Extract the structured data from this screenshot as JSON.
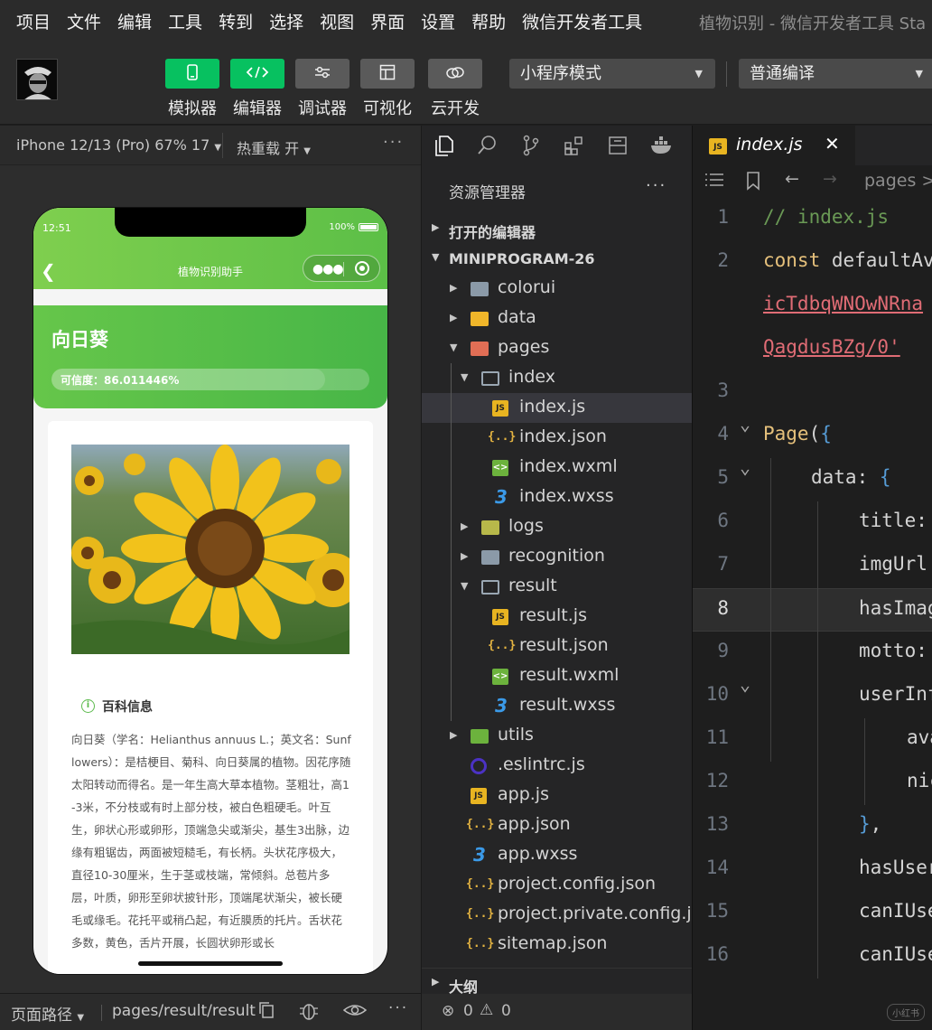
{
  "menubar": {
    "items": [
      "项目",
      "文件",
      "编辑",
      "工具",
      "转到",
      "选择",
      "视图",
      "界面",
      "设置",
      "帮助",
      "微信开发者工具"
    ],
    "window_title": "植物识别 - 微信开发者工具 Sta"
  },
  "toolbar": {
    "buttons": [
      {
        "label": "模拟器",
        "icon": "phone-icon",
        "active": true
      },
      {
        "label": "编辑器",
        "icon": "code-icon",
        "active": true
      },
      {
        "label": "调试器",
        "icon": "debug-icon",
        "active": false
      },
      {
        "label": "可视化",
        "icon": "layout-icon",
        "active": false
      },
      {
        "label": "云开发",
        "icon": "cloud-icon",
        "active": false
      }
    ],
    "mode_select": "小程序模式",
    "compile_select": "普通编译"
  },
  "simulator": {
    "device": "iPhone 12/13 (Pro) 67% 17",
    "hot_reload": "热重载 开",
    "more": "···",
    "status_time": "12:51",
    "battery": "100%",
    "nav_title": "植物识别助手",
    "plant_name": "向日葵",
    "confidence_text": "可信度：86.011446%",
    "confidence_value": 86.011446,
    "baike_title": "百科信息",
    "baike_text": "向日葵（学名：Helianthus annuus L.；英文名：Sunflowers）：是桔梗目、菊科、向日葵属的植物。因花序随太阳转动而得名。是一年生高大草本植物。茎粗壮，高1-3米，不分枝或有时上部分枝，被白色粗硬毛。叶互生，卵状心形或卵形，顶端急尖或渐尖，基生3出脉，边缘有粗锯齿，两面被短糙毛，有长柄。头状花序极大，直径10-30厘米，生于茎或枝端，常倾斜。总苞片多层，叶质，卵形至卵状披针形，顶端尾状渐尖，被长硬毛或缘毛。花托平或稍凸起，有近膜质的托片。舌状花多数，黄色，舌片开展，长圆状卵形或长",
    "footer_path_label": "页面路径",
    "footer_path": "pages/result/result"
  },
  "explorer": {
    "title": "资源管理器",
    "more": "···",
    "open_editors": "打开的编辑器",
    "project": "MINIPROGRAM-26",
    "outline": "大纲",
    "errors": "0",
    "warnings": "0",
    "tree": [
      {
        "name": "colorui",
        "type": "folder",
        "depth": 1,
        "chev": "▶"
      },
      {
        "name": "data",
        "type": "folder-data",
        "depth": 1,
        "chev": "▶"
      },
      {
        "name": "pages",
        "type": "folder-pages",
        "depth": 1,
        "chev": "▼"
      },
      {
        "name": "index",
        "type": "folder-open",
        "depth": 2,
        "chev": "▼"
      },
      {
        "name": "index.js",
        "type": "js",
        "depth": 3,
        "selected": true
      },
      {
        "name": "index.json",
        "type": "json",
        "depth": 3
      },
      {
        "name": "index.wxml",
        "type": "wxml",
        "depth": 3
      },
      {
        "name": "index.wxss",
        "type": "wxss",
        "depth": 3
      },
      {
        "name": "logs",
        "type": "folder-logs",
        "depth": 2,
        "chev": "▶"
      },
      {
        "name": "recognition",
        "type": "folder",
        "depth": 2,
        "chev": "▶"
      },
      {
        "name": "result",
        "type": "folder-open",
        "depth": 2,
        "chev": "▼"
      },
      {
        "name": "result.js",
        "type": "js",
        "depth": 3
      },
      {
        "name": "result.json",
        "type": "json",
        "depth": 3
      },
      {
        "name": "result.wxml",
        "type": "wxml",
        "depth": 3
      },
      {
        "name": "result.wxss",
        "type": "wxss",
        "depth": 3
      },
      {
        "name": "utils",
        "type": "folder-utils",
        "depth": 1,
        "chev": "▶"
      },
      {
        "name": ".eslintrc.js",
        "type": "eslint",
        "depth": 1
      },
      {
        "name": "app.js",
        "type": "js",
        "depth": 1
      },
      {
        "name": "app.json",
        "type": "json",
        "depth": 1
      },
      {
        "name": "app.wxss",
        "type": "wxss",
        "depth": 1
      },
      {
        "name": "project.config.json",
        "type": "json",
        "depth": 1
      },
      {
        "name": "project.private.config.js...",
        "type": "json",
        "depth": 1
      },
      {
        "name": "sitemap.json",
        "type": "json",
        "depth": 1
      }
    ]
  },
  "editor": {
    "tab_name": "index.js",
    "breadcrumb": "pages >",
    "current_line": 8,
    "lines": [
      {
        "n": "1",
        "tokens": [
          {
            "c": "c-comment",
            "t": "// index.js"
          }
        ]
      },
      {
        "n": "2",
        "tokens": [
          {
            "c": "c-keyword",
            "t": "const "
          },
          {
            "c": "c-plain",
            "t": "defaultAv"
          }
        ]
      },
      {
        "n": "",
        "tokens": [
          {
            "c": "c-string",
            "t": "icTdbqWNOwNRna"
          }
        ]
      },
      {
        "n": "",
        "tokens": [
          {
            "c": "c-string",
            "t": "QagdusBZg/0'"
          }
        ]
      },
      {
        "n": "3",
        "tokens": []
      },
      {
        "n": "4",
        "tokens": [
          {
            "c": "c-func",
            "t": "Page"
          },
          {
            "c": "c-plain",
            "t": "("
          },
          {
            "c": "c-brace",
            "t": "{"
          }
        ],
        "fold": true
      },
      {
        "n": "5",
        "tokens": [
          {
            "c": "c-prop",
            "t": "data"
          },
          {
            "c": "c-plain",
            "t": ": "
          },
          {
            "c": "c-brace",
            "t": "{"
          }
        ],
        "fold": true,
        "indent": 1
      },
      {
        "n": "6",
        "tokens": [
          {
            "c": "c-prop",
            "t": "title:"
          }
        ],
        "indent": 2
      },
      {
        "n": "7",
        "tokens": [
          {
            "c": "c-prop",
            "t": "imgUrl"
          }
        ],
        "indent": 2
      },
      {
        "n": "8",
        "tokens": [
          {
            "c": "c-prop",
            "t": "hasImag"
          }
        ],
        "indent": 2
      },
      {
        "n": "9",
        "tokens": [
          {
            "c": "c-prop",
            "t": "motto:"
          }
        ],
        "indent": 2
      },
      {
        "n": "10",
        "tokens": [
          {
            "c": "c-prop",
            "t": "userInf"
          }
        ],
        "indent": 2,
        "fold": true
      },
      {
        "n": "11",
        "tokens": [
          {
            "c": "c-prop",
            "t": "ava"
          }
        ],
        "indent": 3
      },
      {
        "n": "12",
        "tokens": [
          {
            "c": "c-prop",
            "t": "nic"
          }
        ],
        "indent": 3
      },
      {
        "n": "13",
        "tokens": [
          {
            "c": "c-brace",
            "t": "}"
          },
          {
            "c": "c-plain",
            "t": ","
          }
        ],
        "indent": 2
      },
      {
        "n": "14",
        "tokens": [
          {
            "c": "c-prop",
            "t": "hasUser"
          }
        ],
        "indent": 2
      },
      {
        "n": "15",
        "tokens": [
          {
            "c": "c-prop",
            "t": "canIUse"
          }
        ],
        "indent": 2
      },
      {
        "n": "16",
        "tokens": [
          {
            "c": "c-prop",
            "t": "canIUse"
          }
        ],
        "indent": 2
      }
    ],
    "watermark": "小红书"
  }
}
